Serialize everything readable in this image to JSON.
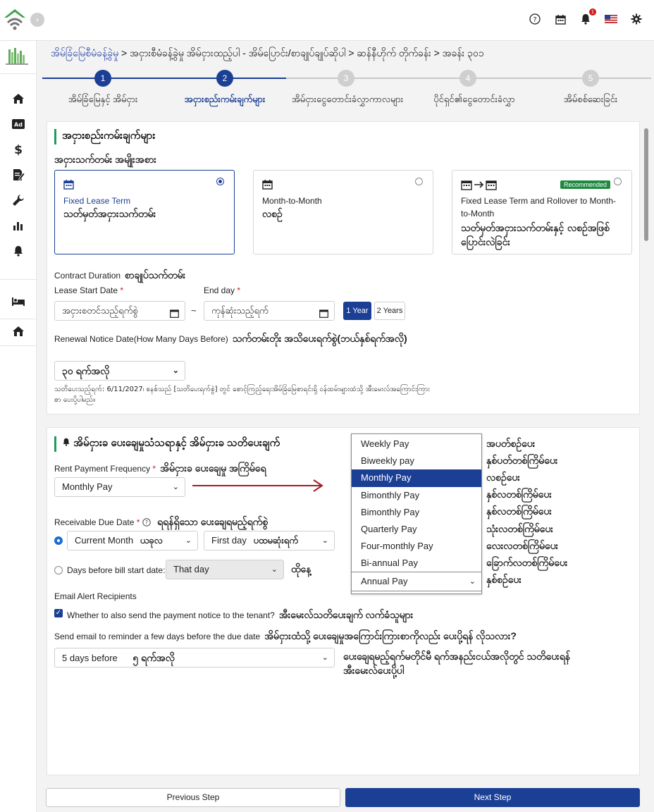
{
  "topbar": {
    "icons": [
      "help-icon",
      "calendar-icon",
      "bell-icon",
      "us-flag-icon",
      "gear-icon"
    ],
    "notification_count": "1"
  },
  "sidebar": {
    "items": [
      "home-icon",
      "ad-icon",
      "dollar-icon",
      "edit-document-icon",
      "wrench-icon",
      "bar-chart-icon",
      "bell-icon",
      "bed-icon",
      "house-icon"
    ]
  },
  "breadcrumb": {
    "first": "အိမ်ခြံမြေစီမံခန့်ခွဲမှု",
    "rest": " > အငှားစီမံခန့်ခွဲမှု အိမ်ငှားထည့်ပါ - အိမ်ပြောင်း/စာချုပ်ချုပ်ဆိုပါ > ဆန်နီဟိုက် တိုက်ခန်း > အခန်း ၃၀၁"
  },
  "steps": [
    {
      "num": "1",
      "label": "အိမ်ခြံမြေနှင့် အိမ်ငှား"
    },
    {
      "num": "2",
      "label": "အငှားစည်းကမ်းချက်များ"
    },
    {
      "num": "3",
      "label": "အိမ်ငှားငွေတောင်းခံလွှာကာလများ"
    },
    {
      "num": "4",
      "label": "ပိုင်ရှင်၏ငွေတောင်းခံလွှာ"
    },
    {
      "num": "5",
      "label": "အိမ်စစ်ဆေးခြင်း"
    }
  ],
  "lease_terms": {
    "title": "အငှားစည်းကမ်းချက်များ",
    "type_label": "အငှားသက်တမ်း အမျိုးအစား",
    "options": [
      {
        "en": "Fixed Lease Term",
        "mm": "သတ်မှတ်အငှားသက်တမ်း",
        "selected": true
      },
      {
        "en": "Month-to-Month",
        "mm": "လစဉ်",
        "selected": false
      },
      {
        "en": "Fixed Lease Term and Rollover to Month-to-Month",
        "mm": "သတ်မှတ်အငှားသက်တမ်းနှင့် လစဉ်အဖြစ်ပြောင်းလဲခြင်း",
        "badge": "Recommended",
        "selected": false
      }
    ],
    "contract_duration_en": "Contract Duration",
    "contract_duration_mm": "စာချုပ်သက်တမ်း",
    "start_label": "Lease Start Date",
    "end_label": "End day",
    "start_placeholder": "အငှားစတင်သည့်ရက်စွဲ",
    "end_placeholder": "ကုန်ဆုံးသည့်ရက်",
    "range_sep": "~",
    "btn_1year": "1 Year",
    "btn_2years": "2 Years",
    "renewal_label_en": "Renewal Notice Date(How Many Days Before)",
    "renewal_label_mm": "သက်တမ်းတိုး အသိပေးရက်စွဲ(ဘယ်နှစ်ရက်အလို)",
    "renewal_value": "၃၀ ရက်အလို",
    "renewal_note": "သတိပေးသည့်ရက်: 6/11/2027၊ စနစ်သည် [သတိပေးရက်စွဲ] တွင် စောင့်ကြည့်ရေးအိမ်ခြံမြေစာရင်းရှိ ဝန်ထမ်းများထံသို့ အီးမေးလ်အကြောင်းကြားစာ ပေးပို့ပါမည်။"
  },
  "payment": {
    "title": "အိမ်ငှားခ ပေးချေမှုသံသရာနှင့် အိမ်ငှားခ သတိပေးချက်",
    "freq_label_en": "Rent Payment Frequency",
    "freq_label_mm": "အိမ်ငှားခ ပေးချေမှု အကြိမ်ရေ",
    "freq_value": "Monthly Pay",
    "dropdown_options": [
      "Weekly Pay",
      "Biweekly pay",
      "Monthly Pay",
      "Bimonthly Pay",
      "Bimonthly Pay",
      "Quarterly Pay",
      "Four-monthly Pay",
      "Bi-annual Pay"
    ],
    "dropdown_selected_index": 2,
    "dropdown_current": "Annual Pay",
    "option_translations": [
      "အပတ်စဉ်ပေး",
      "နှစ်ပတ်တစ်ကြိမ်ပေး",
      "လစဉ်ပေး",
      "နှစ်လတစ်ကြိမ်ပေး",
      "နှစ်လတစ်ကြိမ်ပေး",
      "သုံးလတစ်ကြိမ်ပေး",
      "လေးလတစ်ကြိမ်ပေး",
      "ခြောက်လတစ်ကြိမ်ပေး",
      "နှစ်စဉ်ပေး"
    ],
    "due_label_en": "Receivable Due Date",
    "due_label_mm": "ရရန်ရှိသော ပေးချေရမည့်ရက်စွဲ",
    "current_month": "Current Month",
    "current_month_mm": "ယခုလ",
    "first_day": "First day",
    "first_day_mm": "ပထမဆုံးရက်",
    "days_before_label": "Days before bill start date:",
    "that_day": "That day",
    "that_day_mm": "ထိုနေ့",
    "email_recipients": "Email Alert Recipients",
    "send_tenant_en": "Whether to also send the payment notice to the tenant?",
    "send_tenant_mm": "အီးမေးလ်သတိပေးချက် လက်ခံသူများ",
    "reminder_label_en": "Send email to reminder a few days before the due date",
    "reminder_label_mm": "အိမ်ငှားထံသို့ ပေးချေမှုအကြောင်းကြားစာကိုလည်း ပေးပို့ရန် လိုသလား?",
    "reminder_value_en": "5 days before",
    "reminder_value_mm": "၅ ရက်အလို",
    "reminder_note_mm_1": "ပေးချေရမည့်ရက်မတိုင်မီ ရက်အနည်းငယ်အလိုတွင် သတိပေးရန်",
    "reminder_note_mm_2": "အီးမေးလ်ပေးပို့ပါ"
  },
  "nav": {
    "prev": "Previous Step",
    "next": "Next Step"
  },
  "colors": {
    "primary": "#1b3f95",
    "accent_green": "#1e9c5d",
    "arrow_red": "#a01c24"
  }
}
